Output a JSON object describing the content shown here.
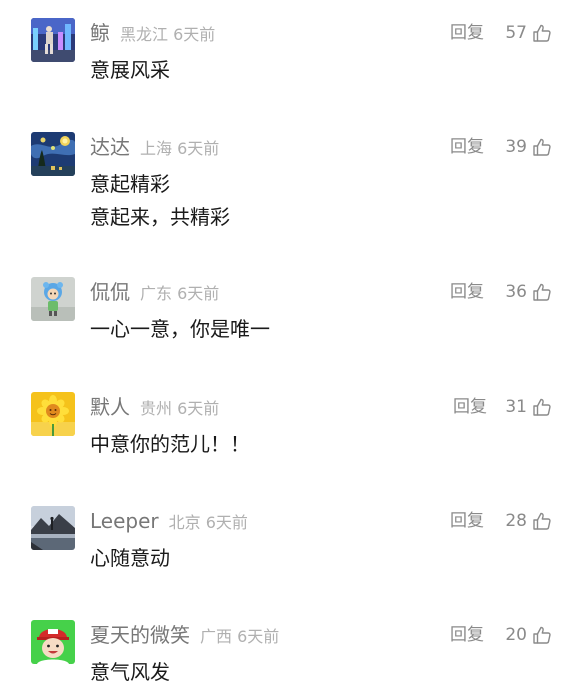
{
  "comments": [
    {
      "nickname": "鲸",
      "location": "黑龙江",
      "time": "6天前",
      "reply_label": "回复",
      "likes": "57",
      "lines": [
        "意展风采"
      ],
      "avatar": "city-night-photo"
    },
    {
      "nickname": "达达",
      "location": "上海",
      "time": "6天前",
      "reply_label": "回复",
      "likes": "39",
      "lines": [
        "意起精彩",
        "意起来，共精彩"
      ],
      "avatar": "starry-night-painting"
    },
    {
      "nickname": "侃侃",
      "location": "广东",
      "time": "6天前",
      "reply_label": "回复",
      "likes": "36",
      "lines": [
        "一心一意，你是唯一"
      ],
      "avatar": "cartoon-figurine"
    },
    {
      "nickname": "默人",
      "location": "贵州",
      "time": "6天前",
      "reply_label": "回复",
      "likes": "31",
      "lines": [
        "中意你的范儿！！"
      ],
      "avatar": "sunflower"
    },
    {
      "nickname": "Leeper",
      "location": "北京",
      "time": "6天前",
      "reply_label": "回复",
      "likes": "28",
      "lines": [
        "心随意动"
      ],
      "avatar": "mountain-lake-silhouette"
    },
    {
      "nickname": "夏天的微笑",
      "location": "广西",
      "time": "6天前",
      "reply_label": "回复",
      "likes": "20",
      "lines": [
        "意气风发"
      ],
      "avatar": "cartoon-boy-red-cap"
    }
  ],
  "colors": {
    "nickname": "#777777",
    "meta": "#b0b0b0",
    "action": "#8a8a8a",
    "text": "#1a1a1a"
  },
  "icons": {
    "like": "thumbs-up-icon"
  }
}
